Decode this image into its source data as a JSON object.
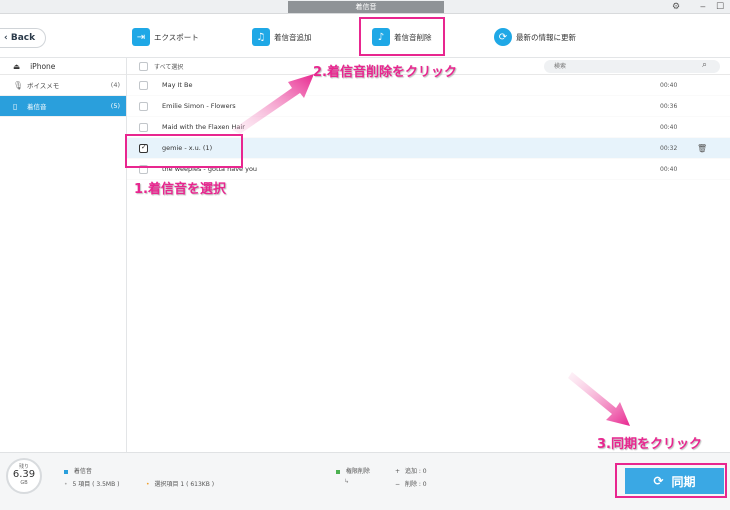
{
  "window": {
    "title": "着信音",
    "ctrl_settings": "⚙",
    "ctrl_min": "‒",
    "ctrl_max": "☐"
  },
  "toolbar": {
    "back_label": "Back",
    "tools": [
      {
        "label": "エクスポート",
        "icon": "export-icon"
      },
      {
        "label": "着信音追加",
        "icon": "add-ringtone-icon"
      },
      {
        "label": "着信音削除",
        "icon": "delete-ringtone-icon"
      },
      {
        "label": "最新の情報に更新",
        "icon": "refresh-icon"
      }
    ]
  },
  "sidebar": {
    "device": "iPhone",
    "items": [
      {
        "label": "ボイスメモ",
        "count": "(4)",
        "icon": "microphone-icon"
      },
      {
        "label": "着信音",
        "count": "(5)",
        "icon": "ringtone-icon",
        "active": true
      }
    ]
  },
  "list": {
    "select_all": "すべて選択",
    "search_placeholder": "検索",
    "rows": [
      {
        "name": "May It Be",
        "duration": "00:40",
        "checked": false
      },
      {
        "name": "Emilie Simon - Flowers",
        "duration": "00:36",
        "checked": false
      },
      {
        "name": "Maid with the Flaxen Hair",
        "duration": "00:40",
        "checked": false
      },
      {
        "name": "gemie - x.u. (1)",
        "duration": "00:32",
        "checked": true
      },
      {
        "name": "the weepies - gotta have you",
        "duration": "00:40",
        "checked": false
      }
    ]
  },
  "annotations": {
    "step1": "1.着信音を選択",
    "step2": "2.着信音削除をクリック",
    "step3": "3.同期をクリック"
  },
  "bottom": {
    "storage_label": "残り",
    "storage_value": "6.39",
    "storage_unit": "GB",
    "category": "着信音",
    "items_info": "5 項目 ( 3.5MB )",
    "selected_info": "選択項目 1 ( 613KB )",
    "perm_delete": "権限削除",
    "add_info": "追加 : 0",
    "del_info": "削除 : 0",
    "sync_label": "同期"
  },
  "colors": {
    "accent": "#2a9fdc",
    "annotation": "#e8268f"
  }
}
